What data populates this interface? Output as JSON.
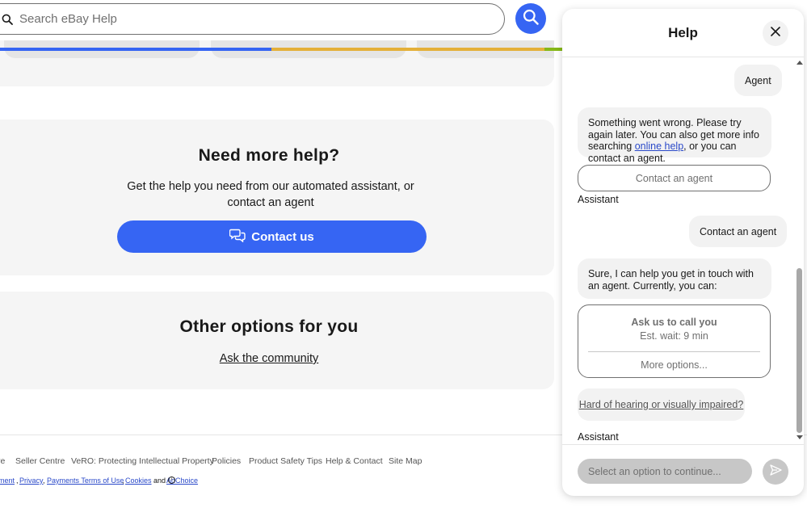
{
  "search": {
    "placeholder": "Search eBay Help"
  },
  "colors": {
    "brand_blue": "#3665f3",
    "bar_blue": "#3665f3",
    "bar_yellow": "#e4b03a",
    "bar_green": "#86b817"
  },
  "help": {
    "title": "Need more help?",
    "subtitle": "Get the help you need from our automated assistant, or contact an agent",
    "contact_button": "Contact us"
  },
  "options": {
    "title": "Other options for you",
    "community_link": "Ask the community"
  },
  "footer": {
    "links": [
      "re",
      "Seller Centre",
      "VeRO: Protecting Intellectual Property",
      "Policies",
      "Product Safety Tips",
      "Help & Contact",
      "Site Map"
    ],
    "legal": {
      "item_1": "ment",
      "sep_1": ",",
      "privacy": "Privacy",
      "sep_2": ",",
      "payments_terms": "Payments Terms of Use",
      "sep_3": ",",
      "cookies": "Cookies",
      "and": "and",
      "adchoice": "AdChoice"
    }
  },
  "panel": {
    "title": "Help",
    "messages": {
      "user_1": "Agent",
      "bot_1_text": "Something went wrong. Please try again later. You can also get more info searching",
      "bot_1_link": "online help",
      "bot_1_tail": ", or you can contact an agent.",
      "option_1": "Contact an agent",
      "assistant_label_1": "Assistant",
      "user_2": "Contact an agent",
      "bot_2_text": "Sure, I can help you get in touch with an agent. Currently, you can:",
      "call_title": "Ask us to call you",
      "call_wait": "Est. wait: 9 min",
      "call_more": "More options...",
      "hearing": "Hard of hearing or visually impaired?",
      "assistant_label_2": "Assistant"
    },
    "input_placeholder": "Select an option to continue..."
  }
}
